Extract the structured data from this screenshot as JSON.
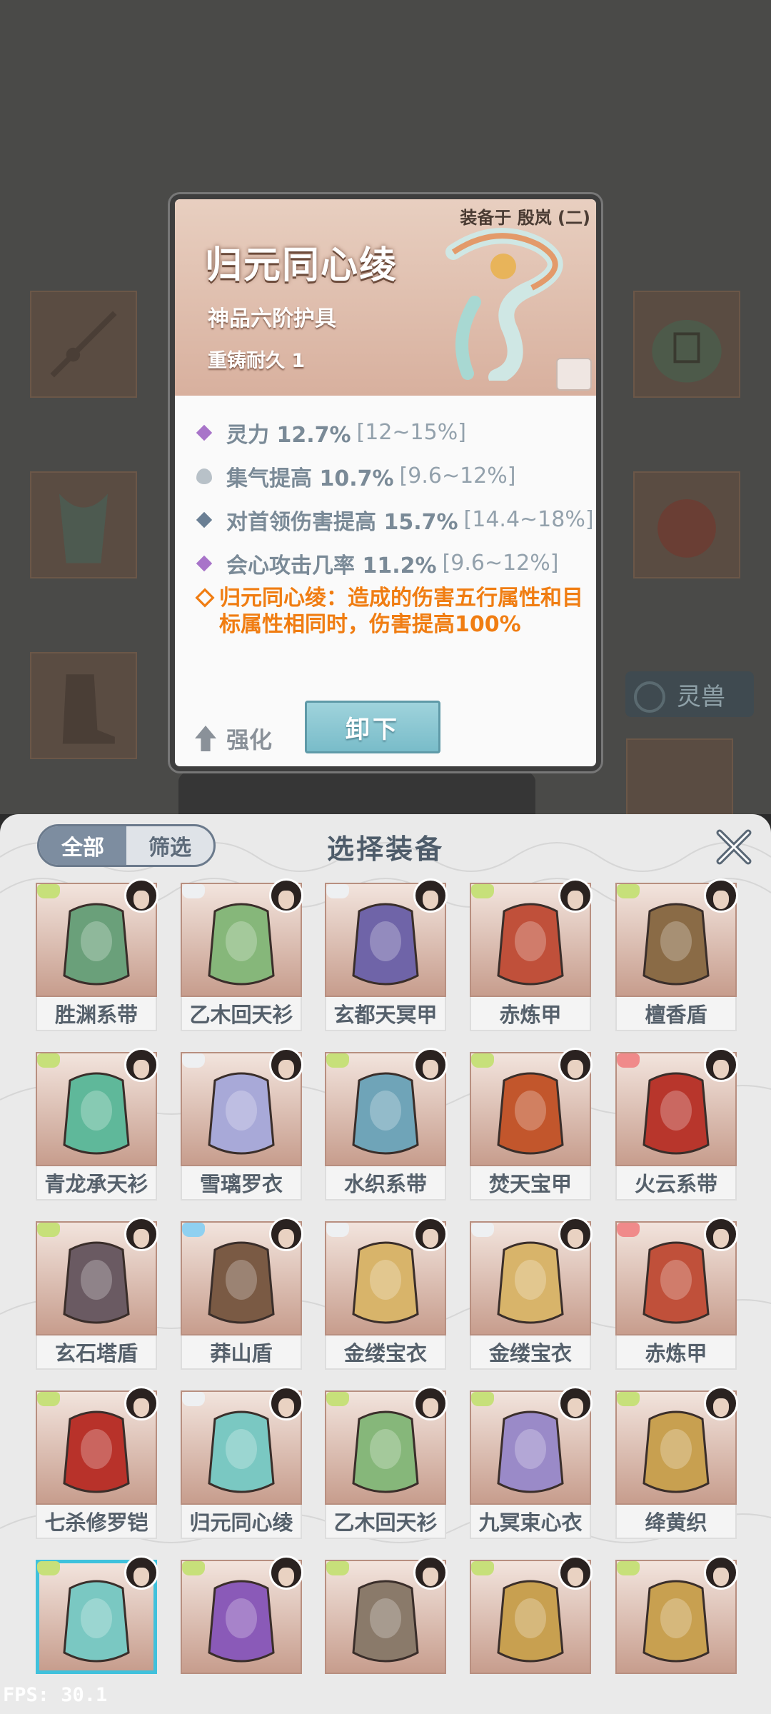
{
  "item_detail": {
    "equipped_label": "装备于 殷岚 (二)",
    "name": "归元同心绫",
    "grade": "神品六阶护具",
    "durability": "重铸耐久 1",
    "stats": [
      {
        "text": "灵力 12.7%",
        "range": "[12~15%]",
        "marker": "purple-diamond-icon"
      },
      {
        "text": "集气提高 10.7%",
        "range": "[9.6~12%]",
        "marker": "flame-icon"
      },
      {
        "text": "对首领伤害提高 15.7%",
        "range": "[14.4~18%]",
        "marker": "blue-diamond-icon"
      },
      {
        "text": "会心攻击几率 11.2%",
        "range": "[9.6~12%]",
        "marker": "purple-diamond-icon"
      }
    ],
    "special_effect": "归元同心绫：造成的伤害五行属性和目标属性相同时，伤害提高100%",
    "enhance_label": "强化",
    "unequip_label": "卸下"
  },
  "background": {
    "pet_tab_label": "灵兽"
  },
  "panel": {
    "filter_all": "全部",
    "filter_screen": "筛选",
    "title": "选择装备",
    "close_icon": "close-x-icon"
  },
  "equipment": [
    {
      "name": "胜渊系带",
      "color": "#6aa07a",
      "attr": "#c7e07a"
    },
    {
      "name": "乙木回天衫",
      "color": "#86b77a",
      "attr": "#eef0f2"
    },
    {
      "name": "玄都天冥甲",
      "color": "#6f64a8",
      "attr": "#eef0f2"
    },
    {
      "name": "赤炼甲",
      "color": "#c0503a",
      "attr": "#c7e07a"
    },
    {
      "name": "檀香盾",
      "color": "#8a6b46",
      "attr": "#c7e07a"
    },
    {
      "name": "青龙承天衫",
      "color": "#5fb89a",
      "attr": "#c7e07a"
    },
    {
      "name": "雪璃罗衣",
      "color": "#a8a9d8",
      "attr": "#eef0f2"
    },
    {
      "name": "水织系带",
      "color": "#6fa4b8",
      "attr": "#c7e07a"
    },
    {
      "name": "焚天宝甲",
      "color": "#c2562c",
      "attr": "#c7e07a"
    },
    {
      "name": "火云系带",
      "color": "#b8362c",
      "attr": "#f08a8a"
    },
    {
      "name": "玄石塔盾",
      "color": "#6a5a62",
      "attr": "#c7e07a"
    },
    {
      "name": "莽山盾",
      "color": "#7a5a44",
      "attr": "#8fd0f0"
    },
    {
      "name": "金缕宝衣",
      "color": "#d8b46a",
      "attr": "#eef0f2"
    },
    {
      "name": "金缕宝衣",
      "color": "#d8b46a",
      "attr": "#eef0f2"
    },
    {
      "name": "赤炼甲",
      "color": "#c0503a",
      "attr": "#f08a8a"
    },
    {
      "name": "七杀修罗铠",
      "color": "#b8322a",
      "attr": "#c7e07a"
    },
    {
      "name": "归元同心绫",
      "color": "#7ac8c2",
      "attr": "#eef0f2"
    },
    {
      "name": "乙木回天衫",
      "color": "#86b77a",
      "attr": "#c7e07a"
    },
    {
      "name": "九冥束心衣",
      "color": "#9a8ac8",
      "attr": "#c7e07a"
    },
    {
      "name": "绛黄织",
      "color": "#c8a050",
      "attr": "#c7e07a"
    },
    {
      "name": "",
      "color": "#7ac8c2",
      "attr": "#c7e07a",
      "selected": true
    },
    {
      "name": "",
      "color": "#8a5ab8",
      "attr": "#c7e07a"
    },
    {
      "name": "",
      "color": "#8a7a6a",
      "attr": "#c7e07a"
    },
    {
      "name": "",
      "color": "#c8a050",
      "attr": "#c7e07a"
    },
    {
      "name": "",
      "color": "#c8a050",
      "attr": "#c7e07a"
    }
  ],
  "fps": "FPS: 30.1"
}
